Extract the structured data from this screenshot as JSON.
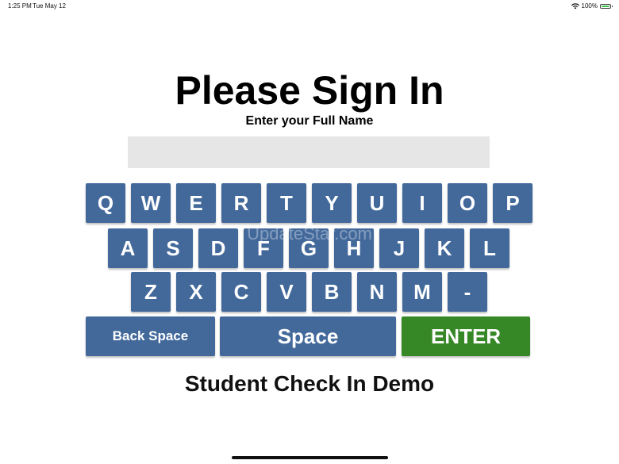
{
  "status_bar": {
    "time": "1:25 PM",
    "date": "Tue May 12",
    "battery": "100%",
    "wifi_icon": "wifi-icon",
    "battery_icon": "battery-icon"
  },
  "header": {
    "title": "Please Sign In",
    "subtitle": "Enter your Full Name"
  },
  "name_input": {
    "value": "",
    "placeholder": ""
  },
  "keyboard": {
    "row1": [
      "Q",
      "W",
      "E",
      "R",
      "T",
      "Y",
      "U",
      "I",
      "O",
      "P"
    ],
    "row2": [
      "A",
      "S",
      "D",
      "F",
      "G",
      "H",
      "J",
      "K",
      "L"
    ],
    "row3": [
      "Z",
      "X",
      "C",
      "V",
      "B",
      "N",
      "M",
      "-"
    ],
    "backspace_label": "Back Space",
    "space_label": "Space",
    "enter_label": "ENTER",
    "key_color": "#43699b",
    "enter_color": "#368827"
  },
  "watermark": "UpdateStar.com",
  "footer": {
    "title": "Student Check In Demo"
  }
}
